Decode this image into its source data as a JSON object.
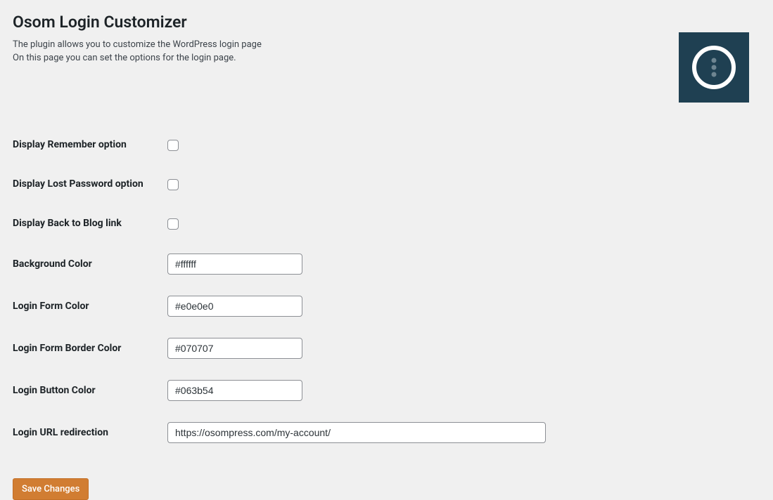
{
  "header": {
    "title": "Osom Login Customizer",
    "description_line1": "The plugin allows you to customize the WordPress login page",
    "description_line2": "On this page you can set the options for the login page."
  },
  "logo": {
    "background": "#1f4052",
    "ring": "#ffffff",
    "dots": "#6e8591"
  },
  "fields": {
    "display_remember": {
      "label": "Display Remember option",
      "checked": false
    },
    "display_lost_password": {
      "label": "Display Lost Password option",
      "checked": false
    },
    "display_back_to_blog": {
      "label": "Display Back to Blog link",
      "checked": false
    },
    "background_color": {
      "label": "Background Color",
      "value": "#ffffff"
    },
    "login_form_color": {
      "label": "Login Form Color",
      "value": "#e0e0e0"
    },
    "login_form_border_color": {
      "label": "Login Form Border Color",
      "value": "#070707"
    },
    "login_button_color": {
      "label": "Login Button Color",
      "value": "#063b54"
    },
    "login_url_redirection": {
      "label": "Login URL redirection",
      "value": "https://osompress.com/my-account/"
    }
  },
  "submit": {
    "label": "Save Changes"
  }
}
